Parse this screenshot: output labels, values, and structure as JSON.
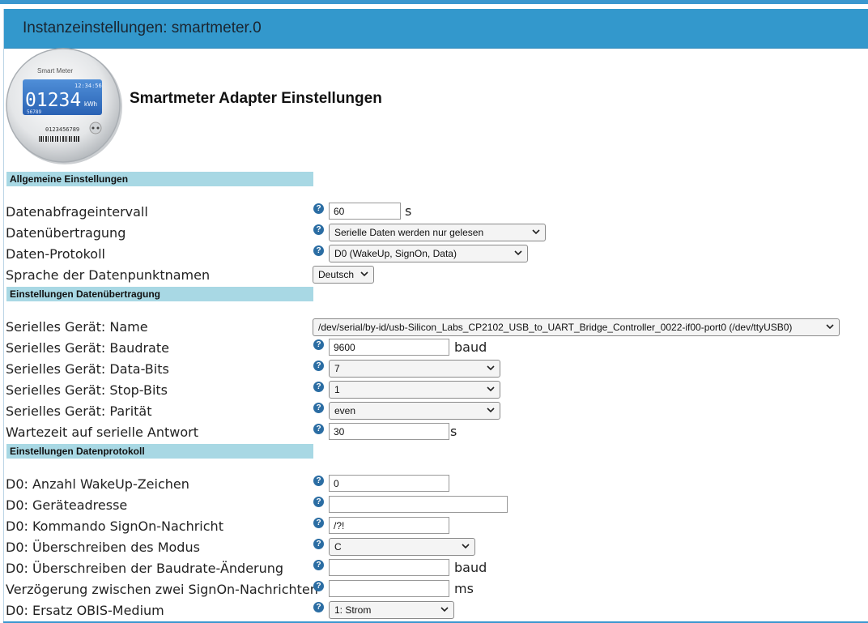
{
  "window": {
    "title": "Instanzeinstellungen: smartmeter.0"
  },
  "meter_logo": {
    "brand": "Smart Meter",
    "time": "12:34:56",
    "reading": "01234",
    "unit": "kWh",
    "sub": "56789",
    "serial": "0123456789"
  },
  "heading": "Smartmeter Adapter Einstellungen",
  "help_glyph": "?",
  "sections": {
    "general": "Allgemeine Einstellungen",
    "transfer": "Einstellungen Datenübertragung",
    "protocol": "Einstellungen Datenprotokoll"
  },
  "fields": {
    "interval": {
      "label": "Datenabfrageintervall",
      "value": "60",
      "unit": "s"
    },
    "transmission": {
      "label": "Datenübertragung",
      "value": "Serielle Daten werden nur gelesen"
    },
    "protocol": {
      "label": "Daten-Protokoll",
      "value": "D0 (WakeUp, SignOn, Data)"
    },
    "language": {
      "label": "Sprache der Datenpunktnamen",
      "value": "Deutsch"
    },
    "serial_name": {
      "label": "Serielles Gerät: Name",
      "value": "/dev/serial/by-id/usb-Silicon_Labs_CP2102_USB_to_UART_Bridge_Controller_0022-if00-port0 (/dev/ttyUSB0)"
    },
    "baudrate": {
      "label": "Serielles Gerät: Baudrate",
      "value": "9600",
      "unit": "baud"
    },
    "data_bits": {
      "label": "Serielles Gerät: Data-Bits",
      "value": "7"
    },
    "stop_bits": {
      "label": "Serielles Gerät: Stop-Bits",
      "value": "1"
    },
    "parity": {
      "label": "Serielles Gerät: Parität",
      "value": "even"
    },
    "response_wait": {
      "label": "Wartezeit auf serielle Antwort",
      "value": "30",
      "unit": "s"
    },
    "wakeup_chars": {
      "label": "D0: Anzahl WakeUp-Zeichen",
      "value": "0"
    },
    "device_address": {
      "label": "D0: Geräteadresse",
      "value": ""
    },
    "signon_command": {
      "label": "D0: Kommando SignOn-Nachricht",
      "value": "/?!"
    },
    "mode_override": {
      "label": "D0: Überschreiben des Modus",
      "value": "C"
    },
    "baudrate_change_override": {
      "label": "D0: Überschreiben der Baudrate-Änderung",
      "value": "",
      "unit": "baud"
    },
    "signon_delay": {
      "label": "Verzögerung zwischen zwei SignOn-Nachrichten",
      "value": "",
      "unit": "ms"
    },
    "obis_medium": {
      "label": "D0: Ersatz OBIS-Medium",
      "value": "1: Strom"
    }
  }
}
